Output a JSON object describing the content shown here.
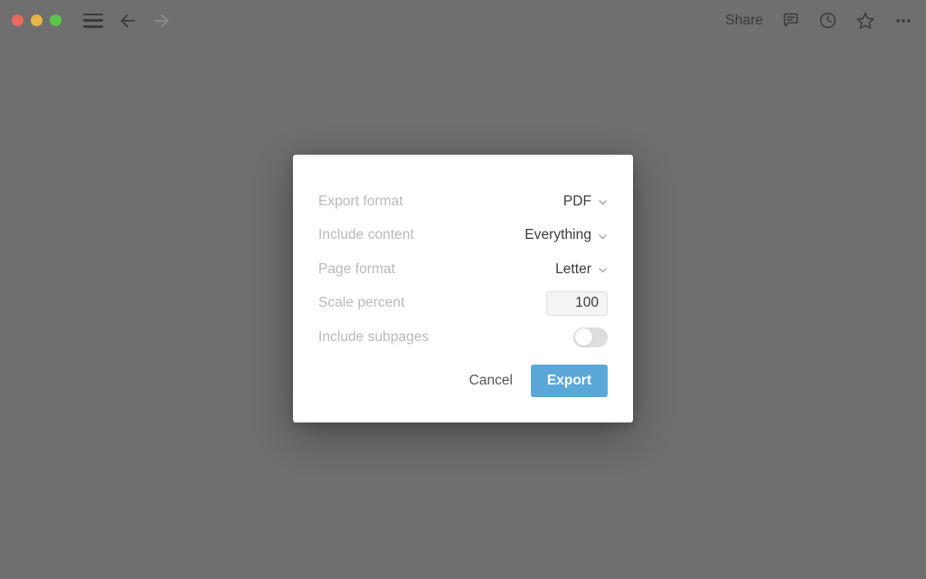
{
  "titlebar": {
    "traffic_lights": [
      {
        "name": "close",
        "color": "#e8695b"
      },
      {
        "name": "minimize",
        "color": "#e9b544"
      },
      {
        "name": "maximize",
        "color": "#5cc44a"
      }
    ],
    "menu_icon": "hamburger-menu-icon",
    "back_icon": "arrow-left-icon",
    "forward_icon": "arrow-right-icon",
    "share_label": "Share",
    "comments_icon": "comment-bubble-icon",
    "history_icon": "clock-icon",
    "favorite_icon": "star-icon",
    "more_icon": "ellipsis-icon"
  },
  "dialog": {
    "rows": [
      {
        "label": "Export format",
        "value": "PDF",
        "control": "select"
      },
      {
        "label": "Include content",
        "value": "Everything",
        "control": "select"
      },
      {
        "label": "Page format",
        "value": "Letter",
        "control": "select"
      },
      {
        "label": "Scale percent",
        "value": "100",
        "control": "number-input",
        "placeholder": "100"
      },
      {
        "label": "Include subpages",
        "value": "off",
        "control": "toggle"
      }
    ],
    "cancel_label": "Cancel",
    "export_label": "Export"
  },
  "colors": {
    "window_background": "#6e6e6e",
    "titlebar_background": "#6f6f6f",
    "dialog_background": "#ffffff",
    "label_text": "#b9b9b9",
    "value_text": "#3b3b3b",
    "accent_blue": "#5ba8d8",
    "toggle_track_off": "#dddddd",
    "input_background": "#f4f4f4"
  }
}
